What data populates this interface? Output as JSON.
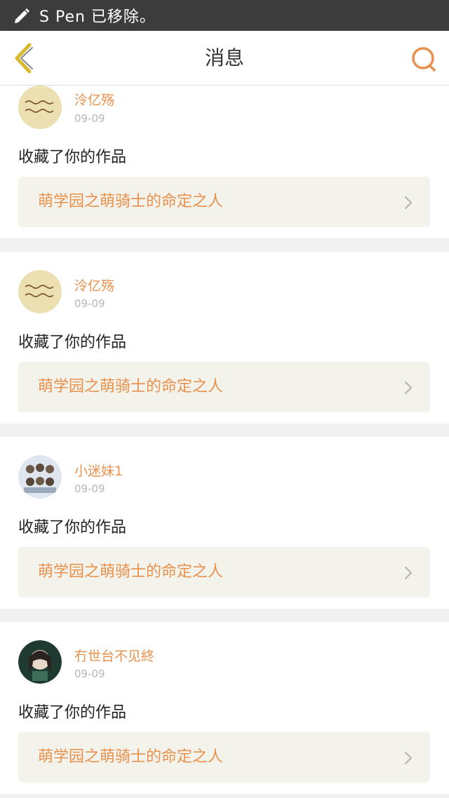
{
  "status_bar": {
    "notification": "S Pen 已移除。"
  },
  "header": {
    "title": "消息",
    "back_icon": "chevron-left-icon",
    "search_icon": "search-icon"
  },
  "colors": {
    "accent": "#e8914d",
    "back_arrow": "#d8b92f"
  },
  "messages": [
    {
      "username": "泠亿殇",
      "date": "09-09",
      "action": "收藏了你的作品",
      "work_title": "萌学园之萌骑士的命定之人"
    },
    {
      "username": "泠亿殇",
      "date": "09-09",
      "action": "收藏了你的作品",
      "work_title": "萌学园之萌骑士的命定之人"
    },
    {
      "username": "小迷妹1",
      "date": "09-09",
      "action": "收藏了你的作品",
      "work_title": "萌学园之萌骑士的命定之人"
    },
    {
      "username": "冇世台不见終",
      "date": "09-09",
      "action": "收藏了你的作品",
      "work_title": "萌学园之萌骑士的命定之人"
    }
  ]
}
